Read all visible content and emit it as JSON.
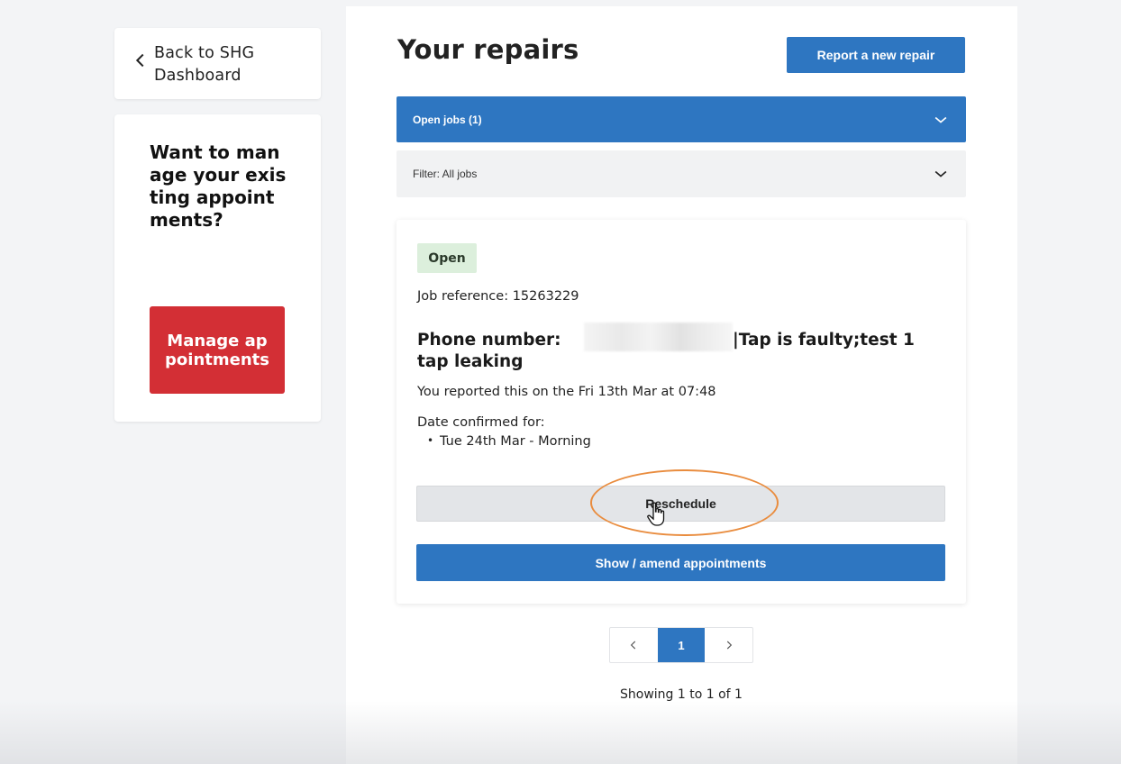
{
  "sidebar": {
    "back_label": "Back to SHG Dashboard",
    "promo_heading": "Want to manage your existing appointments?",
    "manage_button": "Manage appointments"
  },
  "main": {
    "title": "Your repairs",
    "report_button": "Report a new repair",
    "open_jobs_label": "Open jobs (1)",
    "filter_label": "Filter: All jobs"
  },
  "job": {
    "status": "Open",
    "reference_label": "Job reference: 15263229",
    "title_prefix": "Phone number:",
    "title_suffix": "|Tap is faulty;test 1",
    "title_line2": "tap leaking",
    "reported": "You reported this on the Fri 13th Mar at 07:48",
    "confirmed_label": "Date confirmed for:",
    "confirmed_dates": [
      "Tue 24th Mar - Morning"
    ],
    "reschedule_button": "Reschedule",
    "amend_button": "Show / amend appointments"
  },
  "pagination": {
    "current_page": "1",
    "summary": "Showing 1 to 1 of 1"
  },
  "colors": {
    "primary_blue": "#2e76c1",
    "manage_red": "#d32f35",
    "status_green_bg": "#dcefdc",
    "annotation_orange": "#e98c3e"
  }
}
